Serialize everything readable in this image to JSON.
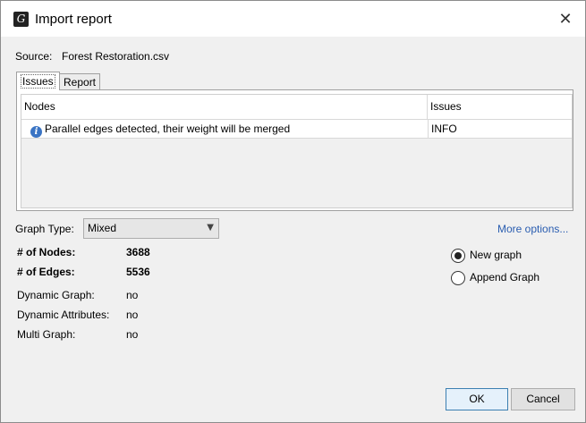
{
  "window": {
    "title": "Import report",
    "close_glyph": "✕"
  },
  "source": {
    "label": "Source:",
    "value": "Forest Restoration.csv"
  },
  "tabs": [
    {
      "label": "Issues"
    },
    {
      "label": "Report"
    }
  ],
  "issues_table": {
    "columns": [
      "Nodes",
      "Issues"
    ],
    "rows": [
      {
        "node": "Parallel edges detected, their weight will be merged",
        "issue": "INFO"
      }
    ]
  },
  "graph_type": {
    "label": "Graph Type:",
    "value": "Mixed"
  },
  "more_options": "More options...",
  "stats": {
    "nodes_label": "# of Nodes:",
    "nodes_value": "3688",
    "edges_label": "# of Edges:",
    "edges_value": "5536",
    "dynamic_graph_label": "Dynamic Graph:",
    "dynamic_graph_value": "no",
    "dynamic_attr_label": "Dynamic Attributes:",
    "dynamic_attr_value": "no",
    "multi_graph_label": "Multi Graph:",
    "multi_graph_value": "no"
  },
  "options": {
    "new_graph": "New graph",
    "append_graph": "Append Graph",
    "selected": "new_graph"
  },
  "buttons": {
    "ok": "OK",
    "cancel": "Cancel"
  }
}
